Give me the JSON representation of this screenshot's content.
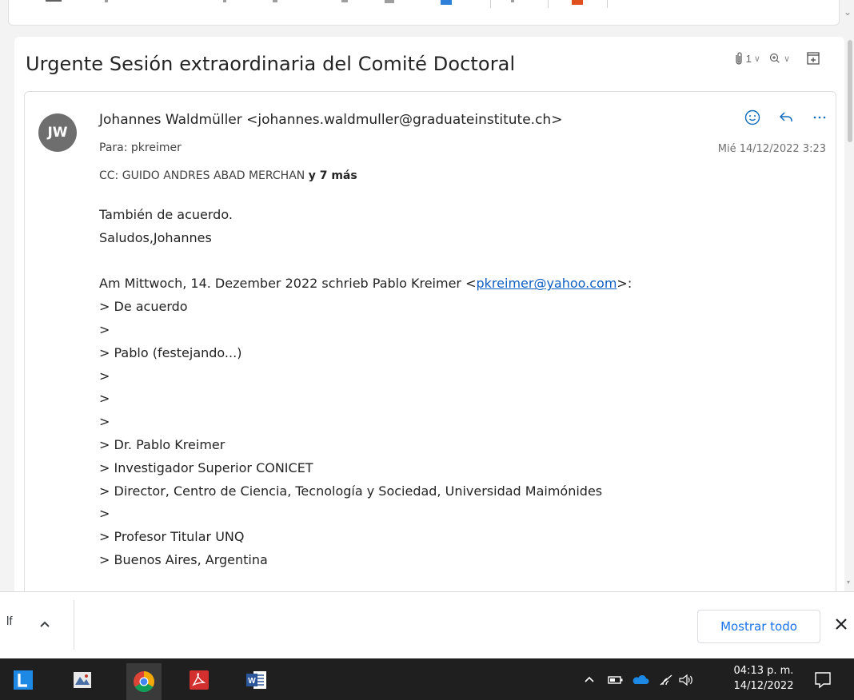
{
  "email": {
    "subject": "Urgente Sesión extraordinaria del Comité Doctoral",
    "attachment_count": "1",
    "sender_initials": "JW",
    "from": "Johannes Waldmüller <johannes.waldmuller@graduateinstitute.ch>",
    "to_label": "Para:",
    "to": "pkreimer",
    "date": "Mié 14/12/2022 3:23",
    "cc_label": "CC:",
    "cc": "GUIDO ANDRES ABAD MERCHAN",
    "cc_more": "y 7 más",
    "body": {
      "line1": "También de acuerdo.",
      "line2": "Saludos,Johannes",
      "quote_intro_pre": "Am Mittwoch, 14. Dezember 2022 schrieb Pablo Kreimer <",
      "quote_link": "pkreimer@yahoo.com",
      "quote_intro_post": ">:",
      "q1": "> De acuerdo",
      "q2": ">",
      "q3": "> Pablo (festejando...)",
      "q4": ">",
      "q5": ">",
      "q6": ">",
      "q7": "> Dr. Pablo Kreimer",
      "q8": "> Investigador Superior CONICET",
      "q9": "> Director, Centro de Ciencia, Tecnología y Sociedad, Universidad Maimónides",
      "q10": ">",
      "q11": "> Profesor Titular UNQ",
      "q12": "> Buenos Aires, Argentina"
    }
  },
  "downloads": {
    "file_fragment": "lf",
    "show_all": "Mostrar todo"
  },
  "taskbar": {
    "time": "04:13 p. m.",
    "date": "14/12/2022"
  },
  "colors": {
    "accent": "#0f6cbd",
    "link": "#0f5fc2",
    "avatar": "#6e6e6e",
    "taskbar": "#1f1f1f"
  }
}
